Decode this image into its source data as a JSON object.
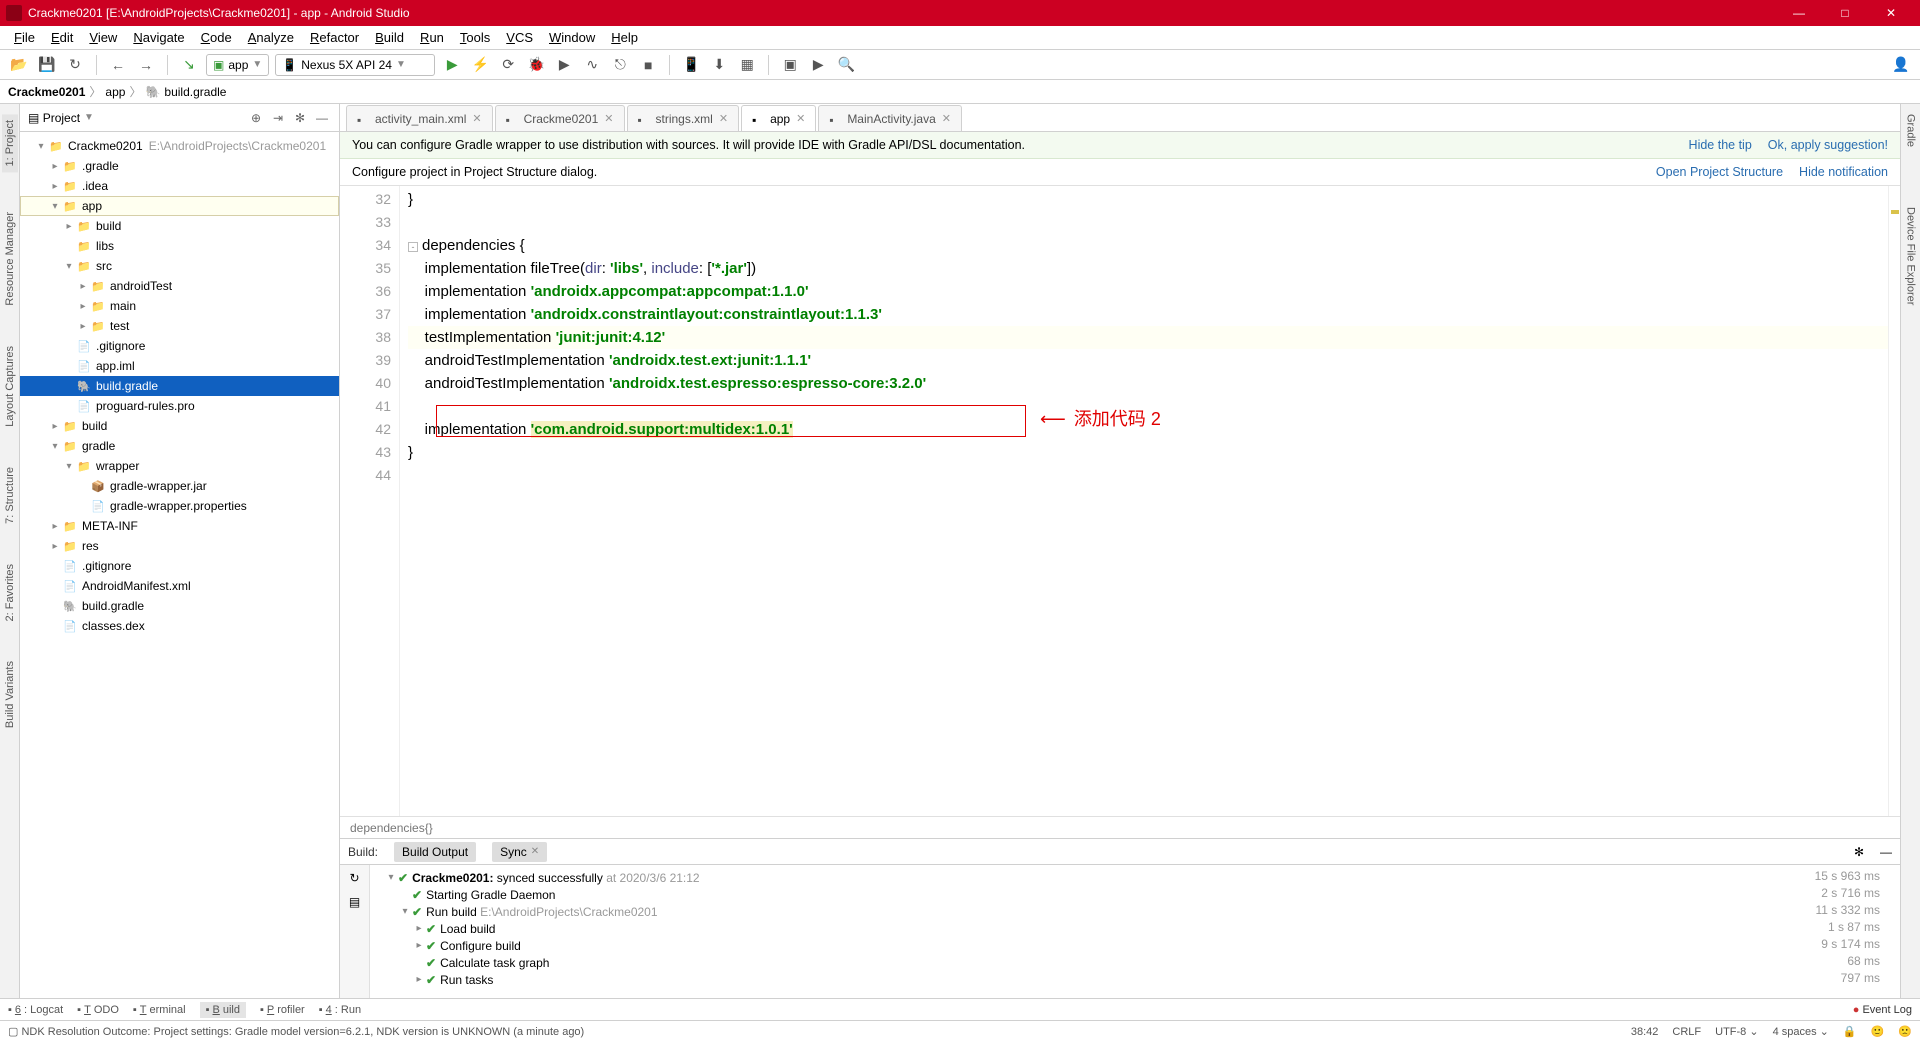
{
  "title": "Crackme0201 [E:\\AndroidProjects\\Crackme0201] - app - Android Studio",
  "menus": [
    "File",
    "Edit",
    "View",
    "Navigate",
    "Code",
    "Analyze",
    "Refactor",
    "Build",
    "Run",
    "Tools",
    "VCS",
    "Window",
    "Help"
  ],
  "run_config": "app",
  "device": "Nexus 5X API 24",
  "breadcrumb": [
    "Crackme0201",
    "app",
    "build.gradle"
  ],
  "proj_label": "Project",
  "tree": [
    {
      "d": 1,
      "exp": "▾",
      "ic": "📁",
      "cls": "folder",
      "label": "Crackme0201",
      "path": "E:\\AndroidProjects\\Crackme0201"
    },
    {
      "d": 2,
      "exp": "▸",
      "ic": "📁",
      "cls": "folder-orange",
      "label": ".gradle"
    },
    {
      "d": 2,
      "exp": "▸",
      "ic": "📁",
      "cls": "folder",
      "label": ".idea"
    },
    {
      "d": 2,
      "exp": "▾",
      "ic": "📁",
      "cls": "folder",
      "label": "app",
      "caret": true
    },
    {
      "d": 3,
      "exp": "▸",
      "ic": "📁",
      "cls": "folder-orange",
      "label": "build"
    },
    {
      "d": 3,
      "exp": "",
      "ic": "📁",
      "cls": "folder",
      "label": "libs"
    },
    {
      "d": 3,
      "exp": "▾",
      "ic": "📁",
      "cls": "folder",
      "label": "src"
    },
    {
      "d": 4,
      "exp": "▸",
      "ic": "📁",
      "cls": "folder",
      "label": "androidTest"
    },
    {
      "d": 4,
      "exp": "▸",
      "ic": "📁",
      "cls": "folder",
      "label": "main"
    },
    {
      "d": 4,
      "exp": "▸",
      "ic": "📁",
      "cls": "folder",
      "label": "test"
    },
    {
      "d": 3,
      "exp": "",
      "ic": "📄",
      "cls": "file",
      "label": ".gitignore"
    },
    {
      "d": 3,
      "exp": "",
      "ic": "📄",
      "cls": "file",
      "label": "app.iml"
    },
    {
      "d": 3,
      "exp": "",
      "ic": "🐘",
      "cls": "file",
      "label": "build.gradle",
      "sel": true
    },
    {
      "d": 3,
      "exp": "",
      "ic": "📄",
      "cls": "file",
      "label": "proguard-rules.pro"
    },
    {
      "d": 2,
      "exp": "▸",
      "ic": "📁",
      "cls": "folder",
      "label": "build"
    },
    {
      "d": 2,
      "exp": "▾",
      "ic": "📁",
      "cls": "folder",
      "label": "gradle"
    },
    {
      "d": 3,
      "exp": "▾",
      "ic": "📁",
      "cls": "folder",
      "label": "wrapper"
    },
    {
      "d": 4,
      "exp": "",
      "ic": "📦",
      "cls": "file",
      "label": "gradle-wrapper.jar"
    },
    {
      "d": 4,
      "exp": "",
      "ic": "📄",
      "cls": "file",
      "label": "gradle-wrapper.properties"
    },
    {
      "d": 2,
      "exp": "▸",
      "ic": "📁",
      "cls": "folder",
      "label": "META-INF"
    },
    {
      "d": 2,
      "exp": "▸",
      "ic": "📁",
      "cls": "folder",
      "label": "res"
    },
    {
      "d": 2,
      "exp": "",
      "ic": "📄",
      "cls": "file",
      "label": ".gitignore"
    },
    {
      "d": 2,
      "exp": "",
      "ic": "📄",
      "cls": "file",
      "label": "AndroidManifest.xml"
    },
    {
      "d": 2,
      "exp": "",
      "ic": "🐘",
      "cls": "file",
      "label": "build.gradle"
    },
    {
      "d": 2,
      "exp": "",
      "ic": "📄",
      "cls": "file",
      "label": "classes.dex"
    }
  ],
  "tabs": [
    {
      "label": "activity_main.xml",
      "active": false
    },
    {
      "label": "Crackme0201",
      "active": false
    },
    {
      "label": "strings.xml",
      "active": false
    },
    {
      "label": "app",
      "active": true
    },
    {
      "label": "MainActivity.java",
      "active": false
    }
  ],
  "banner1": {
    "text": "You can configure Gradle wrapper to use distribution with sources. It will provide IDE with Gradle API/DSL documentation.",
    "link1": "Hide the tip",
    "link2": "Ok, apply suggestion!"
  },
  "banner2": {
    "text": "Configure project in Project Structure dialog.",
    "link1": "Open Project Structure",
    "link2": "Hide notification"
  },
  "code_start": 32,
  "code_lines": [
    {
      "n": 32,
      "html": "}"
    },
    {
      "n": 33,
      "html": ""
    },
    {
      "n": 34,
      "fold": true,
      "html": "dependencies {"
    },
    {
      "n": 35,
      "html": "    implementation fileTree(<span class='prop'>dir</span>: <span class='str'>'libs'</span>, <span class='prop'>include</span>: [<span class='str'>'*.jar'</span>])"
    },
    {
      "n": 36,
      "html": "    implementation <span class='str'>'androidx.appcompat:appcompat:1.1.0'</span>"
    },
    {
      "n": 37,
      "html": "    implementation <span class='str'>'androidx.constraintlayout:constraintlayout:1.1.3'</span>"
    },
    {
      "n": 38,
      "hl": true,
      "html": "    testImplementation <span class='str'>'junit:junit:4.12'</span>"
    },
    {
      "n": 39,
      "html": "    androidTestImplementation <span class='str'>'androidx.test.ext:junit:1.1.1'</span>"
    },
    {
      "n": 40,
      "html": "    androidTestImplementation <span class='str'>'androidx.test.espresso:espresso-core:3.2.0'</span>"
    },
    {
      "n": 41,
      "html": ""
    },
    {
      "n": 42,
      "html": "    implementation <span class='str strhl'>'com.android.support:multidex:1.0.1'</span>"
    },
    {
      "n": 43,
      "html": "}"
    },
    {
      "n": 44,
      "html": ""
    }
  ],
  "annotation": "添加代码 2",
  "crumb2": "dependencies{}",
  "build": {
    "label": "Build:",
    "tabs": [
      "Build Output",
      "Sync"
    ],
    "rows": [
      {
        "d": 1,
        "exp": "▾",
        "ok": true,
        "html": "<b>Crackme0201:</b> synced successfully <span class='grey'>at 2020/3/6 21:12</span>",
        "time": "15 s 963 ms"
      },
      {
        "d": 2,
        "exp": "",
        "ok": true,
        "html": "Starting Gradle Daemon",
        "time": "2 s 716 ms"
      },
      {
        "d": 2,
        "exp": "▾",
        "ok": true,
        "html": "Run build <span class='grey'>E:\\AndroidProjects\\Crackme0201</span>",
        "time": "11 s 332 ms"
      },
      {
        "d": 3,
        "exp": "▸",
        "ok": true,
        "html": "Load build",
        "time": "1 s 87 ms"
      },
      {
        "d": 3,
        "exp": "▸",
        "ok": true,
        "html": "Configure build",
        "time": "9 s 174 ms"
      },
      {
        "d": 3,
        "exp": "",
        "ok": true,
        "html": "Calculate task graph",
        "time": "68 ms"
      },
      {
        "d": 3,
        "exp": "▸",
        "ok": true,
        "html": "Run tasks",
        "time": "797 ms"
      }
    ]
  },
  "bottomtabs": [
    "6: Logcat",
    "TODO",
    "Terminal",
    "Build",
    "Profiler",
    "4: Run"
  ],
  "eventlog": "Event Log",
  "status": {
    "msg": "NDK Resolution Outcome: Project settings: Gradle model version=6.2.1, NDK version is UNKNOWN (a minute ago)",
    "pos": "38:42",
    "eol": "CRLF",
    "enc": "UTF-8",
    "indent": "4 spaces"
  },
  "lefttools": [
    "1: Project",
    "Resource Manager",
    "Layout Captures",
    "7: Structure",
    "2: Favorites",
    "Build Variants"
  ],
  "righttools": [
    "Gradle",
    "Device File Explorer"
  ]
}
